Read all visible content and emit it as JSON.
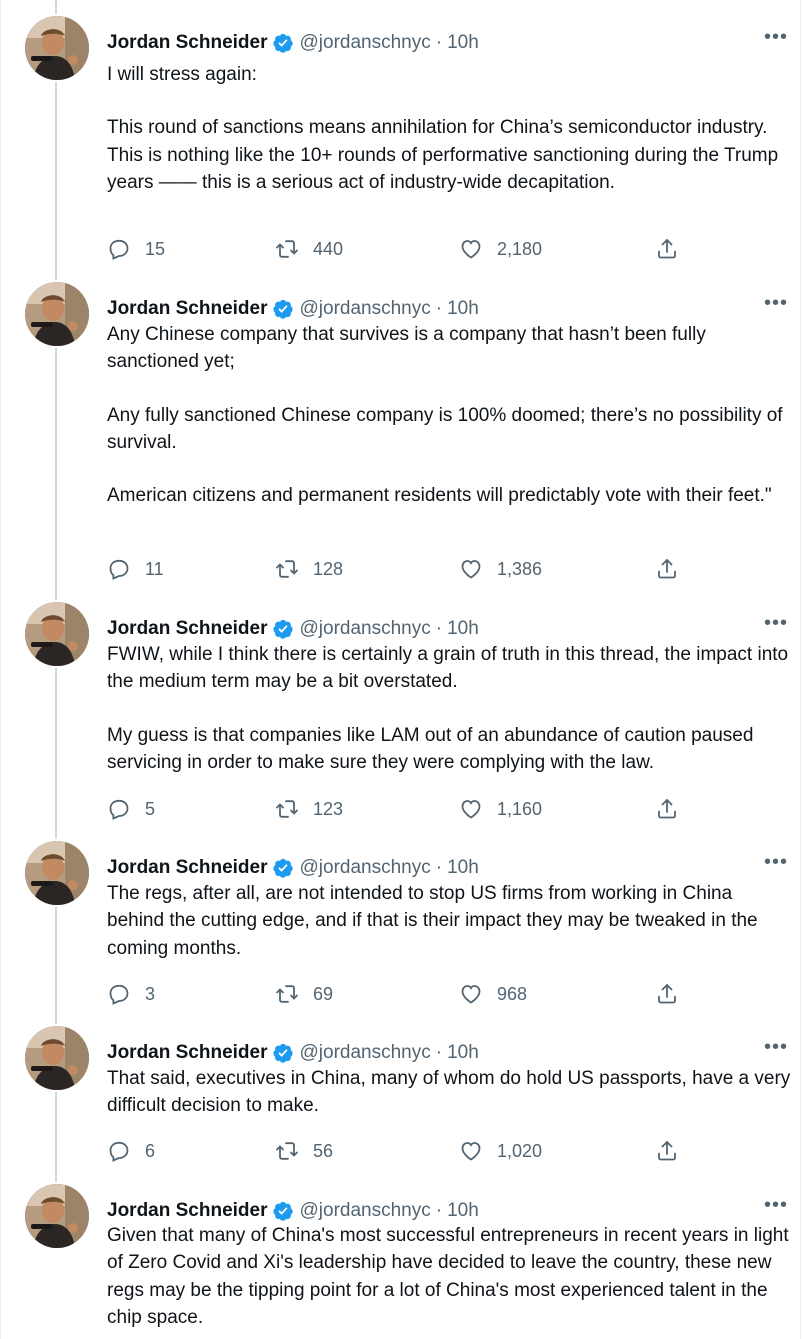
{
  "author": {
    "name": "Jordan Schneider",
    "handle": "@jordanschnyc",
    "separator": "·",
    "time": "10h"
  },
  "more_label": "•••",
  "tweets": [
    {
      "paragraphs": [
        "I will stress again:",
        "This round of sanctions means annihilation for China’s semiconductor industry. This is nothing like the 10+ rounds of performative sanctioning during the Trump years —— this is a serious act of industry-wide decapitation."
      ],
      "replies": "15",
      "retweets": "440",
      "likes": "2,180"
    },
    {
      "paragraphs": [
        "Any Chinese company that survives is a company that hasn’t been fully sanctioned yet;",
        "Any fully sanctioned Chinese company is 100% doomed; there’s no possibility of survival.",
        "American citizens and permanent residents will predictably vote with their feet.\""
      ],
      "replies": "11",
      "retweets": "128",
      "likes": "1,386"
    },
    {
      "paragraphs": [
        "FWIW, while I think there is certainly a grain of truth in this thread, the impact into the medium term may be a bit overstated.",
        "My guess is that companies like LAM out of an abundance of caution paused servicing in order to make sure they were complying with the law."
      ],
      "replies": "5",
      "retweets": "123",
      "likes": "1,160"
    },
    {
      "paragraphs": [
        "The regs, after all, are not intended to stop US firms from working in China behind the cutting edge, and if that is their impact they may be tweaked in the coming months."
      ],
      "replies": "3",
      "retweets": "69",
      "likes": "968"
    },
    {
      "paragraphs": [
        "That said, executives in China, many of whom do hold US passports, have a very difficult decision to make."
      ],
      "replies": "6",
      "retweets": "56",
      "likes": "1,020"
    },
    {
      "paragraphs": [
        "Given that many of China's most successful entrepreneurs in recent years in light of Zero Covid and Xi's leadership have decided to leave the country, these new regs may be the tipping point for a lot of China's most experienced talent in the chip space."
      ]
    }
  ],
  "colors": {
    "text": "#0f1419",
    "secondary": "#536471",
    "verified": "#1d9bf0",
    "thread_line": "#cfd9de"
  },
  "icons": [
    "reply-icon",
    "retweet-icon",
    "like-icon",
    "share-icon",
    "verified-badge-icon",
    "more-icon"
  ]
}
